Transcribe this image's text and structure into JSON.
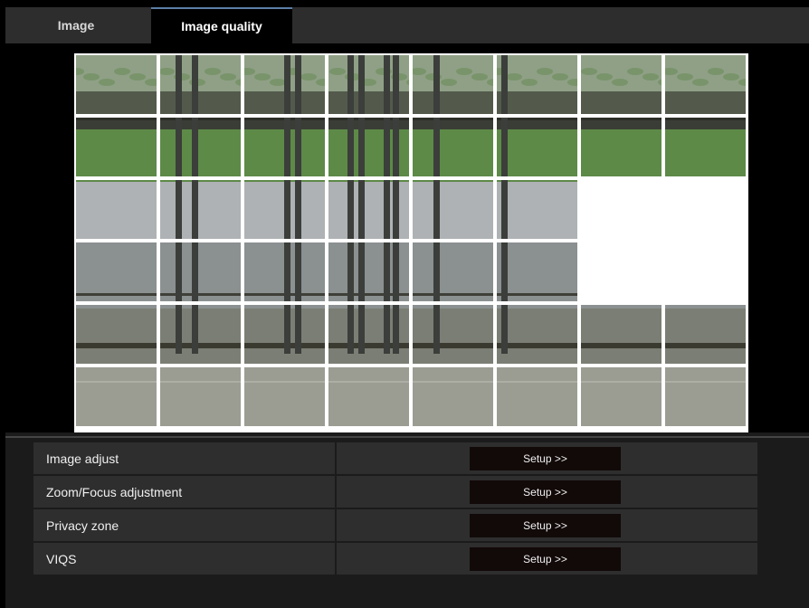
{
  "tabs": [
    {
      "label": "Image",
      "active": false
    },
    {
      "label": "Image quality",
      "active": true
    }
  ],
  "privacy_grid": {
    "columns": 8,
    "rows": 6,
    "masked_cells": [
      [
        2,
        6
      ],
      [
        2,
        7
      ],
      [
        3,
        6
      ],
      [
        3,
        7
      ]
    ]
  },
  "settings": [
    {
      "label": "Image adjust",
      "button": "Setup >>"
    },
    {
      "label": "Zoom/Focus adjustment",
      "button": "Setup >>"
    },
    {
      "label": "Privacy zone",
      "button": "Setup >>"
    },
    {
      "label": "VIQS",
      "button": "Setup >>"
    }
  ],
  "colors": {
    "tab_accent": "#5c7fa8",
    "mask": "#ffffff"
  }
}
